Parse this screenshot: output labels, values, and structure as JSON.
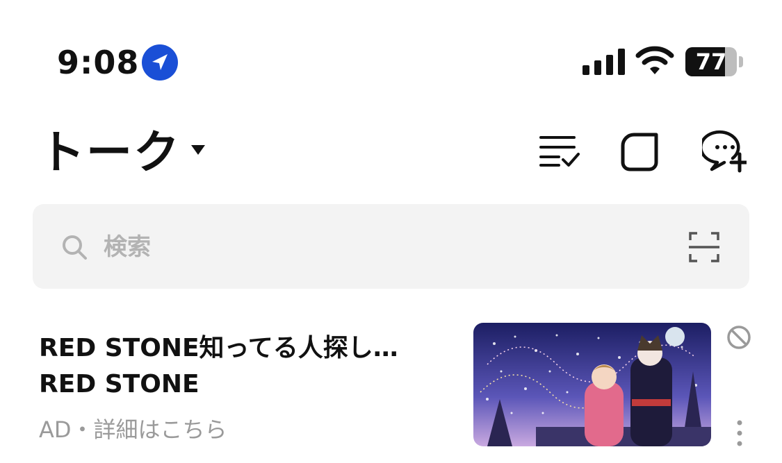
{
  "status_bar": {
    "time": "9:08",
    "battery_level": "77",
    "icons": [
      "location-arrow-icon",
      "cellular-signal-icon",
      "wifi-icon",
      "battery-icon"
    ]
  },
  "header": {
    "title": "トーク",
    "icons": [
      "caret-down-icon",
      "list-check-icon",
      "square-icon",
      "new-chat-icon"
    ]
  },
  "search": {
    "placeholder": "検索",
    "value": "",
    "icons": [
      "search-icon",
      "qr-scan-icon"
    ]
  },
  "ad_item": {
    "title": "RED STONE知ってる人探し…",
    "subtitle": "RED STONE",
    "meta": "AD・詳細はこちら",
    "icons": [
      "block-icon",
      "more-vertical-icon"
    ]
  },
  "colors": {
    "accent": "#1a4fd6",
    "text": "#111111",
    "muted": "#9a9a9a",
    "search_bg": "#f3f3f3"
  }
}
